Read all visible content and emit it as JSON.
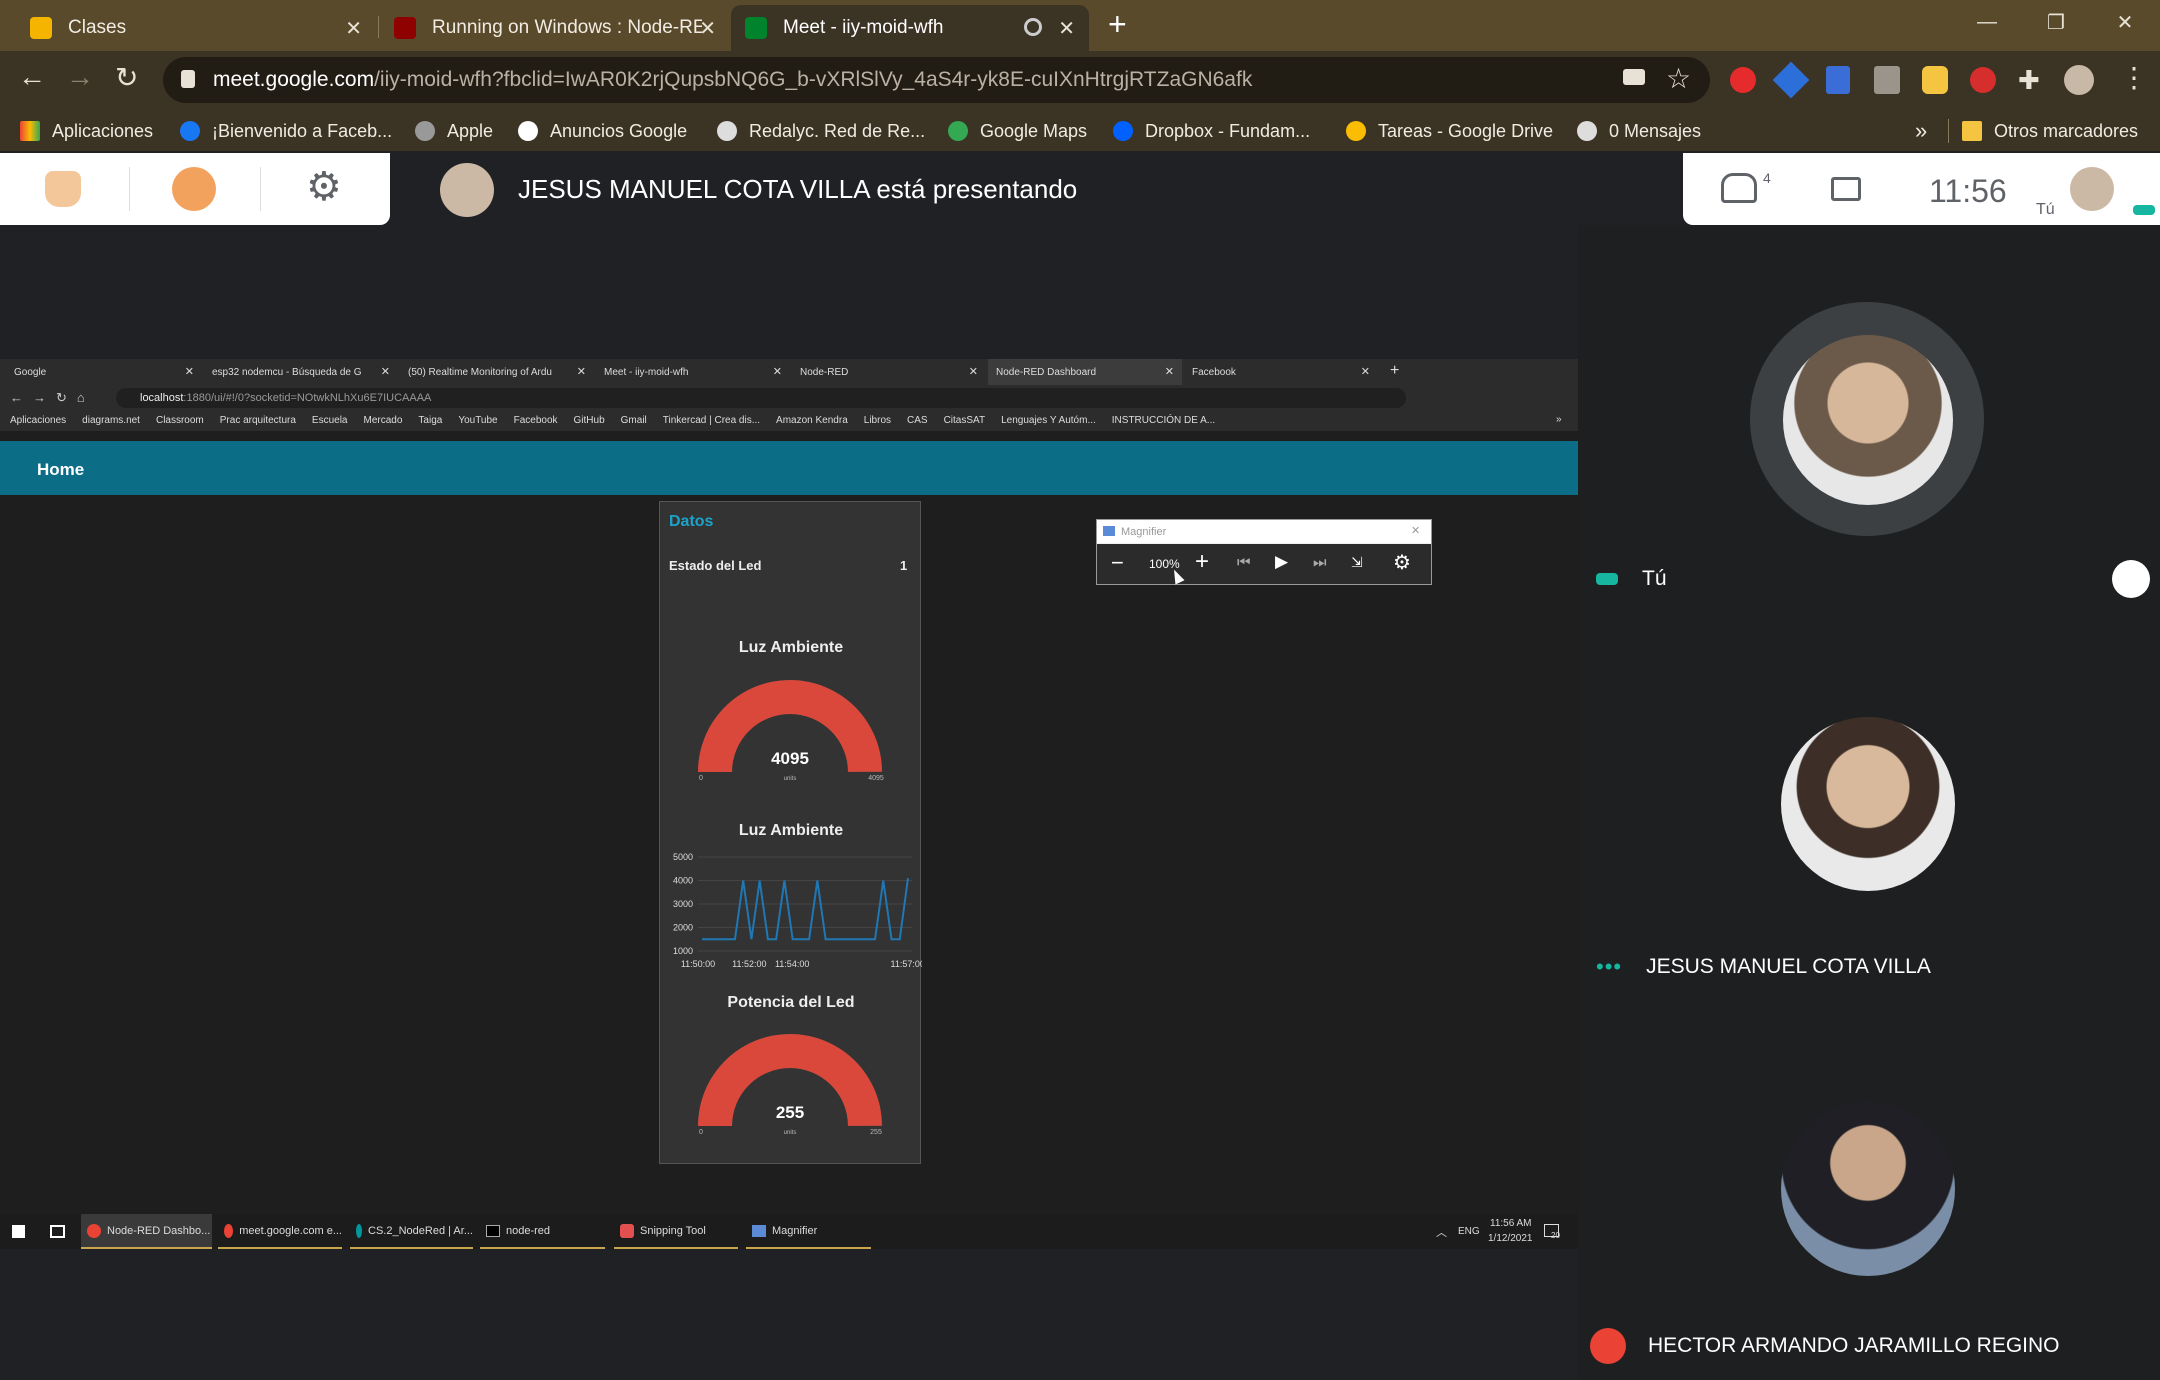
{
  "browser": {
    "tabs": [
      {
        "title": "Clases",
        "color": "#f4b400"
      },
      {
        "title": "Running on Windows : Node-RED",
        "color": "#8f0000"
      },
      {
        "title": "Meet - iiy-moid-wfh",
        "color": "#00832d"
      }
    ],
    "url_host": "meet.google.com",
    "url_path": "/iiy-moid-wfh?fbclid=IwAR0K2rjQupsbNQ6G_b-vXRlSlVy_4aS4r-yk8E-cuIXnHtrgjRTZaGN6afk",
    "bookmarks": [
      {
        "label": "Aplicaciones",
        "color": "#ea4335"
      },
      {
        "label": "¡Bienvenido a Faceb...",
        "color": "#1877f2"
      },
      {
        "label": "Apple",
        "color": "#999999"
      },
      {
        "label": "Anuncios Google",
        "color": "#ffffff"
      },
      {
        "label": "Redalyc. Red de Re...",
        "color": "#ffffff"
      },
      {
        "label": "Google Maps",
        "color": "#34a853"
      },
      {
        "label": "Dropbox - Fundam...",
        "color": "#0061ff"
      },
      {
        "label": "Tareas - Google Drive",
        "color": "#fbbc04"
      },
      {
        "label": "0 Mensajes",
        "color": "#ffffff"
      }
    ],
    "bookmarks_more": "»",
    "other_bookmarks": "Otros marcadores"
  },
  "meet": {
    "presenting_text": "JESUS MANUEL COTA VILLA está presentando",
    "people_count": "4",
    "time": "11:56",
    "self_label": "Tú",
    "participants": [
      {
        "name": "Tú",
        "status": "speaking"
      },
      {
        "name": "JESUS MANUEL COTA VILLA",
        "status": "more"
      },
      {
        "name": "HECTOR ARMANDO JARAMILLO REGINO",
        "status": "muted"
      }
    ]
  },
  "shared": {
    "tabs": [
      {
        "title": "Google"
      },
      {
        "title": "esp32 nodemcu - Búsqueda de G"
      },
      {
        "title": "(50) Realtime Monitoring of Ardu"
      },
      {
        "title": "Meet - iiy-moid-wfh"
      },
      {
        "title": "Node-RED"
      },
      {
        "title": "Node-RED Dashboard"
      },
      {
        "title": "Facebook"
      }
    ],
    "url_host": "localhost",
    "url_rest": ":1880/ui/#!/0?socketid=NOtwkNLhXu6E7IUCAAAA",
    "bookmarks": [
      "Aplicaciones",
      "diagrams.net",
      "Classroom",
      "Prac arquitectura",
      "Escuela",
      "Mercado",
      "Taiga",
      "YouTube",
      "Facebook",
      "GitHub",
      "Gmail",
      "Tinkercad | Crea dis...",
      "Amazon Kendra",
      "Libros",
      "CAS",
      "CitasSAT",
      "Lenguajes Y Autóm...",
      "INSTRUCCIÓN DE A..."
    ],
    "bookmarks_more": "»",
    "dashboard": {
      "header": "Home",
      "group": "Datos",
      "led_label": "Estado del Led",
      "led_value": "1",
      "gauge1": {
        "title": "Luz Ambiente",
        "value": "4095",
        "min": "0",
        "max": "4095",
        "units": "units",
        "fraction": 1.0
      },
      "chart": {
        "title": "Luz Ambiente",
        "yticks": [
          "5000",
          "4000",
          "3000",
          "2000",
          "1000"
        ],
        "xticks": [
          "11:50:00",
          "11:52:00",
          "11:54:00",
          "11:57:00"
        ]
      },
      "gauge2": {
        "title": "Potencia del Led",
        "value": "255",
        "min": "0",
        "max": "255",
        "units": "units",
        "fraction": 1.0
      }
    },
    "magnifier": {
      "title": "Magnifier",
      "zoom": "100%"
    },
    "taskbar": [
      {
        "label": "Node-RED Dashbo..."
      },
      {
        "label": "meet.google.com e..."
      },
      {
        "label": "CS.2_NodeRed | Ar..."
      },
      {
        "label": "node-red"
      },
      {
        "label": "Snipping Tool"
      },
      {
        "label": "Magnifier"
      }
    ],
    "tray": {
      "lang": "ENG",
      "time": "11:56 AM",
      "date": "1/12/2021",
      "notif": "20"
    }
  },
  "chart_data": {
    "type": "line",
    "title": "Luz Ambiente",
    "xlabel": "",
    "ylabel": "",
    "ylim": [
      1000,
      5000
    ],
    "x_ticks": [
      "11:50:00",
      "11:52:00",
      "11:54:00",
      "11:57:00"
    ],
    "series": [
      {
        "values": [
          1500,
          1500,
          1500,
          1500,
          1500,
          4000,
          1500,
          4000,
          1500,
          1500,
          4000,
          1500,
          1500,
          1500,
          4000,
          1500,
          1500,
          1500,
          1500,
          1500,
          1500,
          1500,
          4000,
          1500,
          1500,
          4100
        ]
      }
    ]
  }
}
